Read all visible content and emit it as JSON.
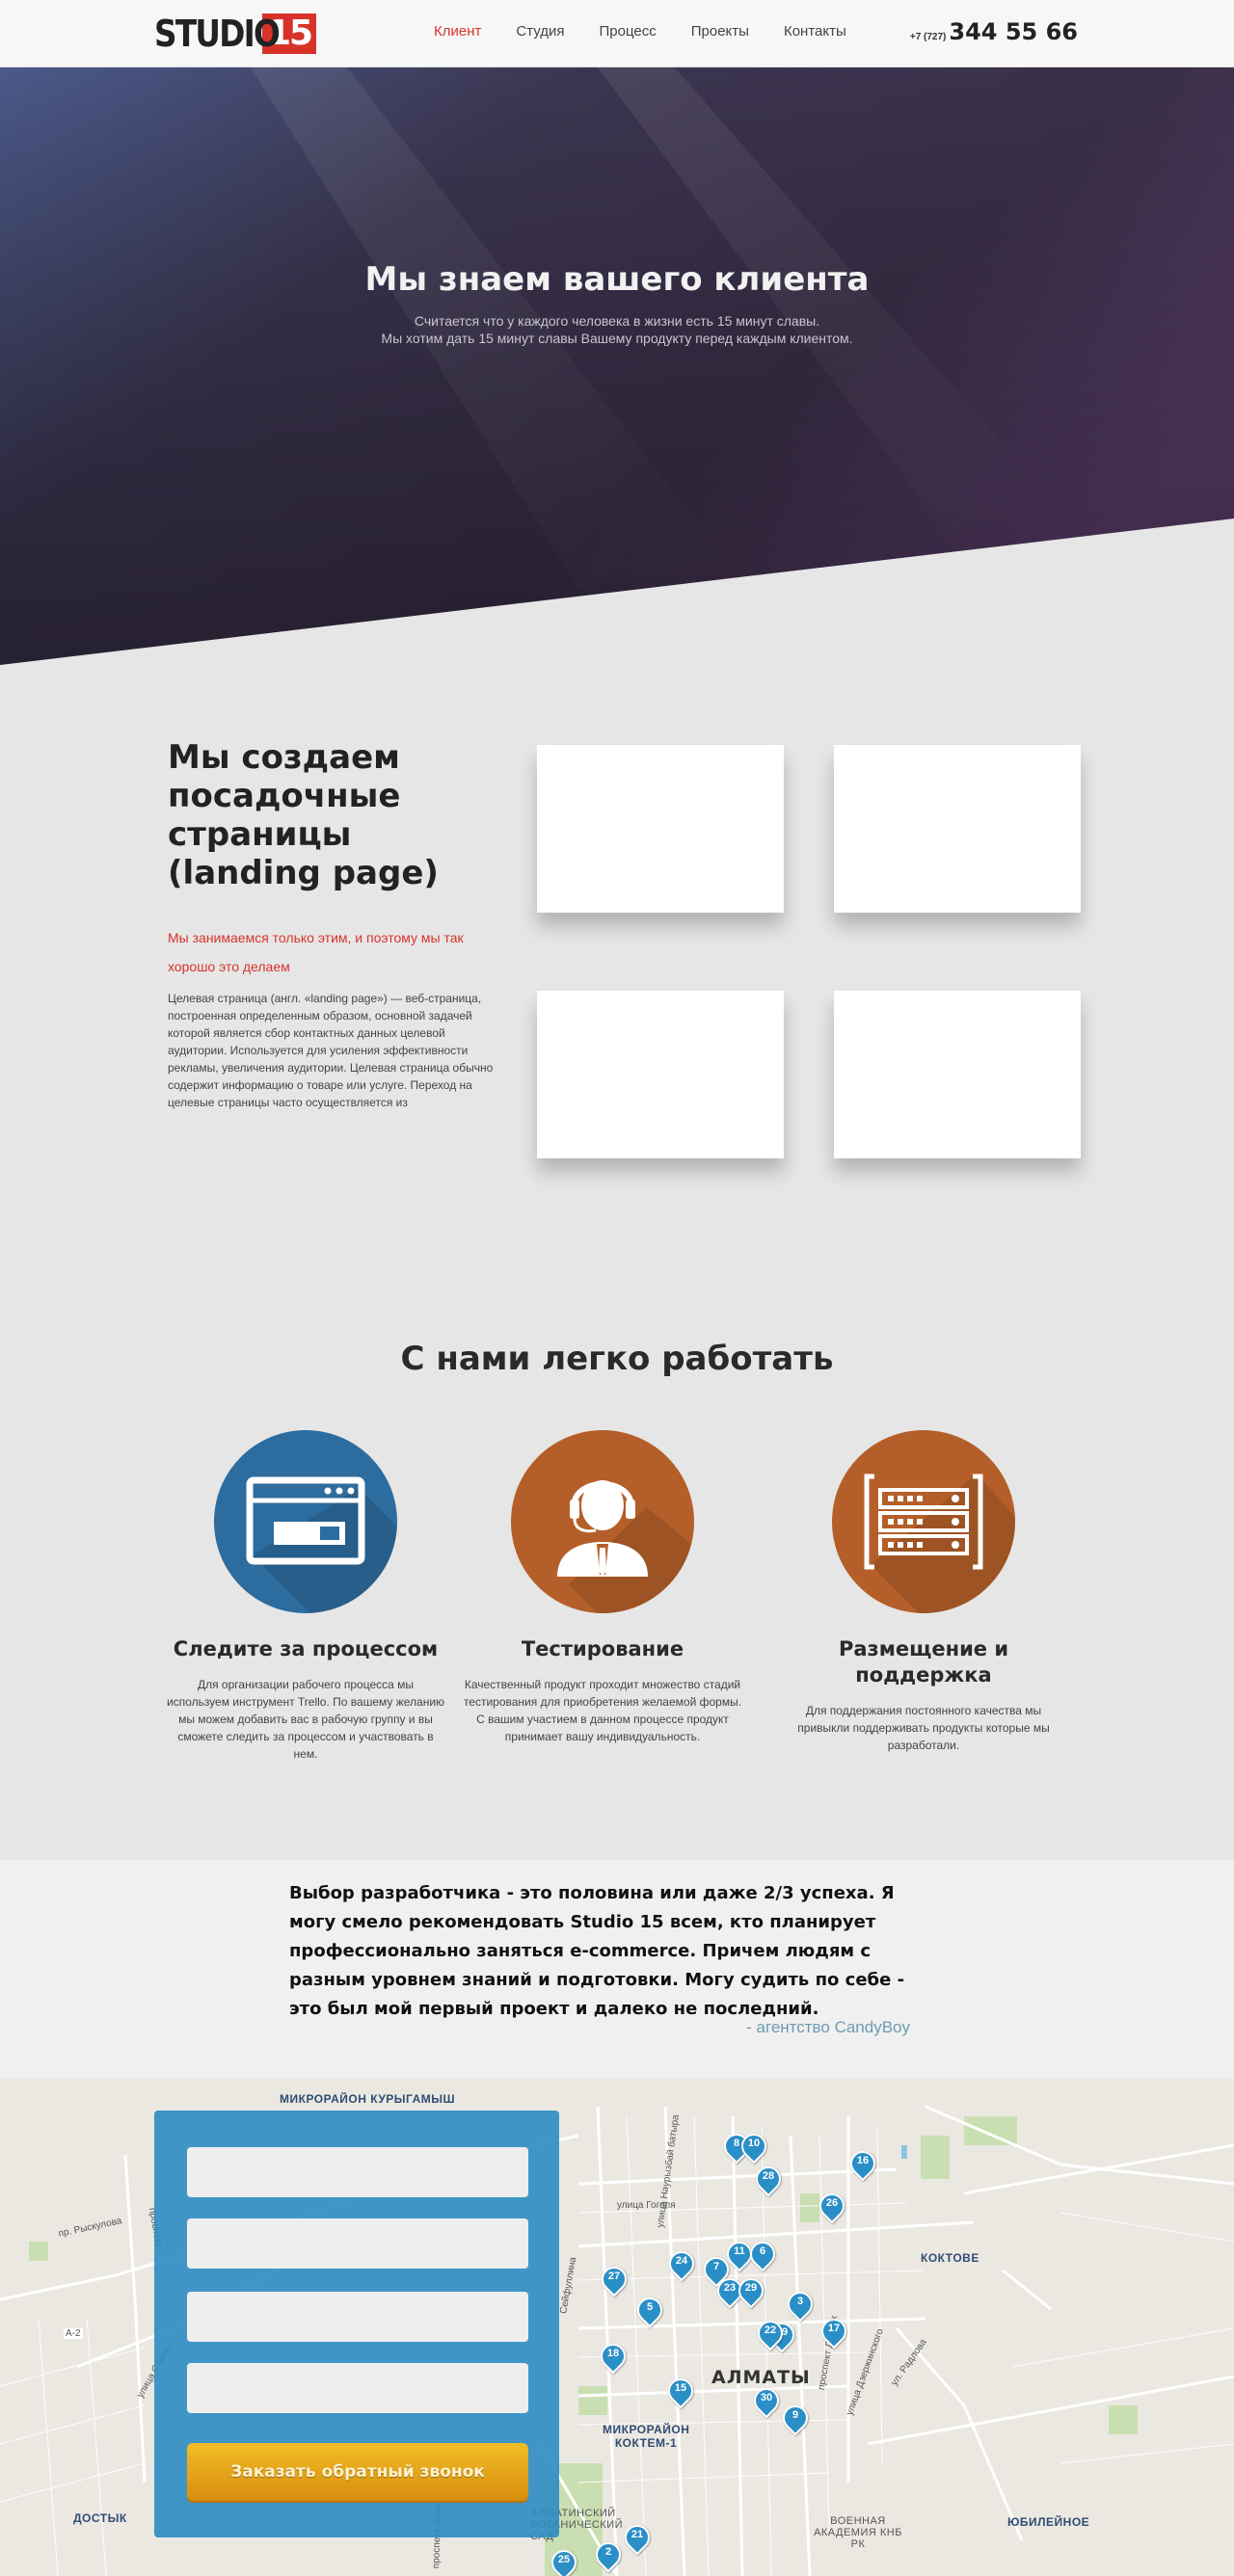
{
  "header": {
    "logo_text": "STUDIO",
    "logo_number": "15",
    "nav": [
      "Клиент",
      "Студия",
      "Процесс",
      "Проекты",
      "Контакты"
    ],
    "active_nav": "Клиент",
    "phone_code": "+7 (727)",
    "phone_number": "344 55 66"
  },
  "hero": {
    "title": "Мы знаем вашего клиента",
    "subtitle_line1": "Считается что у каждого человека в жизни есть 15 минут славы.",
    "subtitle_line2": "Мы хотим дать 15 минут славы Вашему продукту перед каждым клиентом."
  },
  "landing": {
    "title": "Мы создаем посадочные страницы (landing page)",
    "red_text": "Мы занимаемся только этим, и поэтому мы так хорошо это делаем",
    "body": "Целевая страница (англ. «landing page») — веб-страница, построенная определенным образом, основной задачей которой является сбор контактных данных целевой аудитории. Используется для усиления эффективности рекламы, увеличения аудитории. Целевая страница обычно содержит информацию о товаре или услуге. Переход на целевые страницы часто осуществляется из"
  },
  "easy": {
    "title": "С нами легко работать",
    "features": [
      {
        "icon": "browser-window-icon",
        "color": "#2d6c9e",
        "title": "Следите за процессом",
        "text": "Для организации рабочего процесса мы используем инструмент Trello. По вашему желанию мы можем добавить вас в рабочую группу и вы сможете следить за процессом и участвовать в нем."
      },
      {
        "icon": "support-operator-icon",
        "color": "#b45f29",
        "title": "Тестирование",
        "text": "Качественный продукт проходит множество стадий тестирования для приобретения желаемой формы. С вашим участием в данном процессе продукт принимает вашу индивидуальность."
      },
      {
        "icon": "server-rack-icon",
        "color": "#b45f29",
        "title": "Размещение и поддержка",
        "text": "Для поддержания постоянного качества мы привыкли поддерживать продукты которые мы разработали."
      }
    ]
  },
  "testimonial": {
    "quote": "Выбор разработчика - это половина или даже 2/3 успеха. Я могу смело рекомендовать Studio 15 всем, кто планирует профессионально заняться e-commerce. Причем людям с разным уровнем знаний и подготовки. Могу судить по себе - это был мой первый проект и далеко не последний.",
    "author": "- агентство CandyBoy"
  },
  "map": {
    "city": "АЛМАТЫ",
    "districts": [
      "МИКРОРАЙОН КУРЫГАМЫШ",
      "КОКТОВЕ",
      "МИКРОРАЙОН КОКТЕМ-1",
      "ДОСТЫК",
      "ЮБИЛЕЙНОЕ",
      "ВОЕННАЯ АКАДЕМИЯ КНБ РК",
      "АЛМАТИНСКИЙ БОТАНИЧЕСКИЙ САД"
    ],
    "streets": [
      "пр. Рыскулова",
      "проспект",
      "улица Саина",
      "улица Гоголя",
      "улица Наурызбай батыра",
      "проспект Достык",
      "улица Дзержинского",
      "ул. Радлова",
      "А-2",
      "Сейфуллина",
      "проспект Абая"
    ],
    "pins": [
      "8",
      "10",
      "16",
      "28",
      "26",
      "11",
      "6",
      "24",
      "7",
      "27",
      "23",
      "29",
      "5",
      "3",
      "17",
      "19",
      "22",
      "18",
      "15",
      "30",
      "9",
      "21",
      "2",
      "25"
    ]
  },
  "form": {
    "button_label": "Заказать обратный звонок"
  }
}
